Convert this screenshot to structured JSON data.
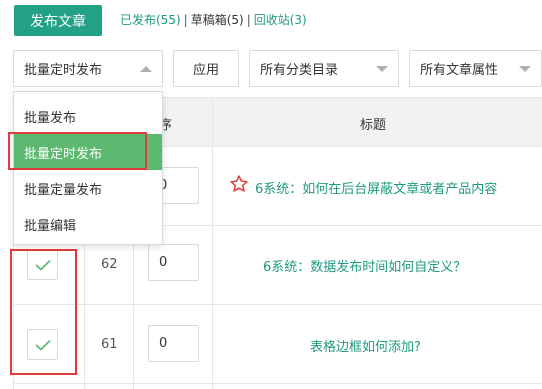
{
  "toolbar": {
    "publish_label": "发布文章",
    "links": [
      {
        "label": "已发布(55)"
      },
      {
        "label": "草稿箱(5)"
      },
      {
        "label": "回收站(3)"
      }
    ],
    "separator": "|"
  },
  "filters": {
    "batch_select": "批量定时发布",
    "apply_label": "应用",
    "category_select": "所有分类目录",
    "attribute_select": "所有文章属性"
  },
  "batch_menu": {
    "items": [
      {
        "label": "批量发布",
        "selected": false
      },
      {
        "label": "批量定时发布",
        "selected": true
      },
      {
        "label": "批量定量发布",
        "selected": false
      },
      {
        "label": "批量编辑",
        "selected": false
      }
    ]
  },
  "table": {
    "columns": {
      "order": "排序",
      "title": "标题"
    },
    "rows": [
      {
        "id": "",
        "order": "0",
        "title": "6系统：如何在后台屏蔽文章或者产品内容",
        "starred": true,
        "checked": false
      },
      {
        "id": "62",
        "order": "0",
        "title": "6系统：数据发布时间如何自定义？",
        "starred": false,
        "checked": true
      },
      {
        "id": "61",
        "order": "0",
        "title": "表格边框如何添加?",
        "starred": false,
        "checked": true
      }
    ]
  },
  "colors": {
    "accent": "#22a186",
    "link": "#1f9a7e",
    "selected_item": "#5cb96f",
    "highlight_frame": "#e23b3b"
  }
}
